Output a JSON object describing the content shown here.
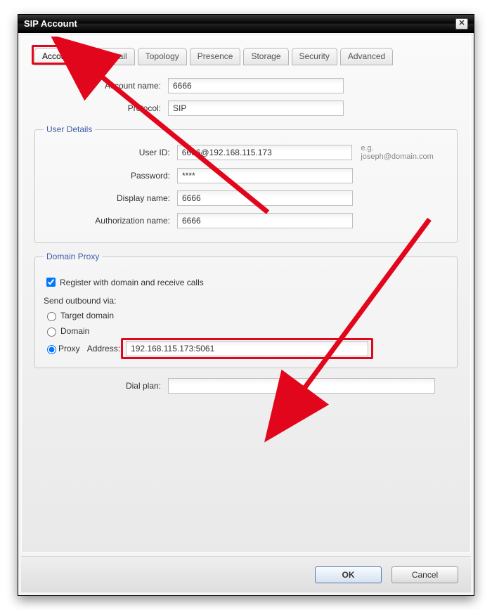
{
  "window": {
    "title": "SIP Account"
  },
  "tabs": {
    "items": [
      {
        "label": "Account"
      },
      {
        "label": "Voicemail"
      },
      {
        "label": "Topology"
      },
      {
        "label": "Presence"
      },
      {
        "label": "Storage"
      },
      {
        "label": "Security"
      },
      {
        "label": "Advanced"
      }
    ]
  },
  "account": {
    "account_name_label": "Account name:",
    "account_name": "6666",
    "protocol_label": "Protocol:",
    "protocol": "SIP"
  },
  "user_details": {
    "legend": "User Details",
    "user_id_label": "User ID:",
    "user_id": "6666@192.168.115.173",
    "user_id_hint": "e.g. joseph@domain.com",
    "password_label": "Password:",
    "password": "****",
    "display_name_label": "Display name:",
    "display_name": "6666",
    "auth_name_label": "Authorization name:",
    "auth_name": "6666"
  },
  "domain_proxy": {
    "legend": "Domain Proxy",
    "register_label": "Register with domain and receive calls",
    "send_label": "Send outbound via:",
    "opt_target": "Target domain",
    "opt_domain": "Domain",
    "opt_proxy": "Proxy",
    "address_label": "Address:",
    "address": "192.168.115.173:5061"
  },
  "dial_plan": {
    "label": "Dial plan:",
    "value": ""
  },
  "buttons": {
    "ok": "OK",
    "cancel": "Cancel"
  }
}
